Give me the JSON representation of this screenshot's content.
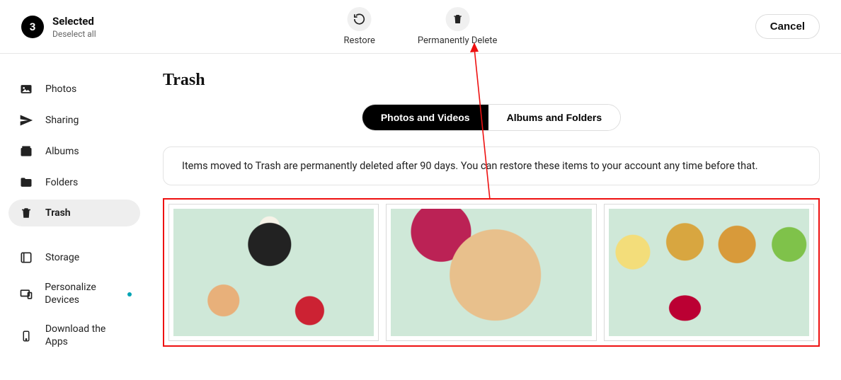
{
  "header": {
    "selected_count": "3",
    "selected_label": "Selected",
    "deselect_label": "Deselect all",
    "actions": {
      "restore": "Restore",
      "delete": "Permanently Delete"
    },
    "cancel": "Cancel"
  },
  "sidebar": {
    "items": [
      {
        "label": "Photos",
        "icon": "photo-icon"
      },
      {
        "label": "Sharing",
        "icon": "share-icon"
      },
      {
        "label": "Albums",
        "icon": "album-icon"
      },
      {
        "label": "Folders",
        "icon": "folder-icon"
      },
      {
        "label": "Trash",
        "icon": "trash-icon",
        "active": true
      }
    ],
    "secondary": [
      {
        "label": "Storage",
        "icon": "storage-icon"
      },
      {
        "label": "Personalize Devices",
        "icon": "devices-icon",
        "dot": true
      },
      {
        "label": "Download the Apps",
        "icon": "download-icon"
      }
    ]
  },
  "main": {
    "title": "Trash",
    "tabs": {
      "photos": "Photos and Videos",
      "albums": "Albums and Folders"
    },
    "notice": "Items moved to Trash are permanently deleted after 90 days. You can restore these items to your account any time before that.",
    "items": [
      {
        "selected": true
      },
      {
        "selected": true
      },
      {
        "selected": true
      }
    ]
  },
  "colors": {
    "selection_outline": "#ee1111",
    "accent_dot": "#00a4b4"
  }
}
